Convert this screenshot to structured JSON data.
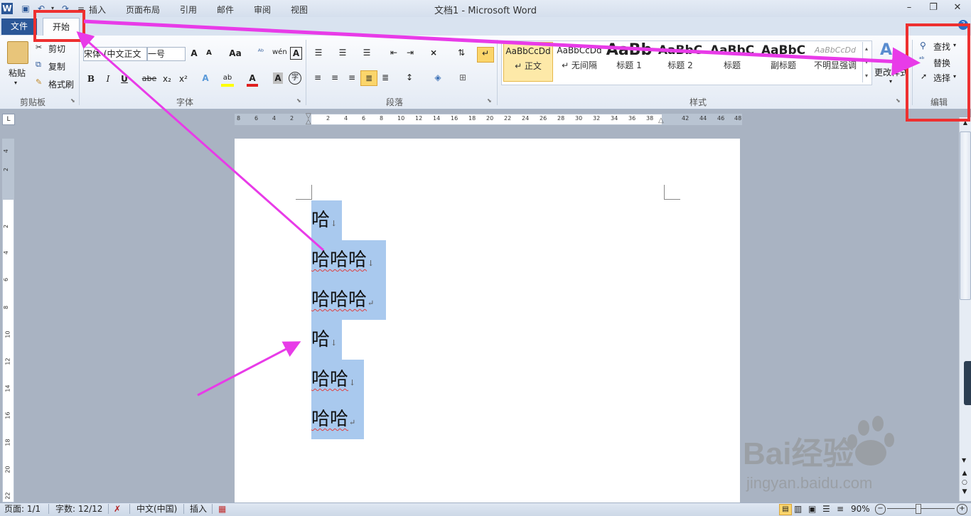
{
  "window": {
    "title": "文档1 - Microsoft Word"
  },
  "tabs": {
    "file": "文件",
    "home": "开始",
    "items": [
      "插入",
      "页面布局",
      "引用",
      "邮件",
      "审阅",
      "视图"
    ]
  },
  "clipboard": {
    "paste": "粘贴",
    "cut": "剪切",
    "copy": "复制",
    "format_painter": "格式刷",
    "label": "剪贴板"
  },
  "font": {
    "name": "宋体 (中文正文",
    "size": "一号",
    "label": "字体",
    "format_buttons": [
      "B",
      "I",
      "U",
      "abe",
      "x₂",
      "x²"
    ]
  },
  "paragraph": {
    "label": "段落"
  },
  "styles": {
    "label": "样式",
    "items": [
      {
        "sample": "AaBbCcDd",
        "name": "↵ 正文"
      },
      {
        "sample": "AaBbCcDd",
        "name": "↵ 无间隔"
      },
      {
        "sample": "AaBb",
        "name": "标题 1"
      },
      {
        "sample": "AaBbC",
        "name": "标题 2"
      },
      {
        "sample": "AaBbC",
        "name": "标题"
      },
      {
        "sample": "AaBbC",
        "name": "副标题"
      },
      {
        "sample": "AaBbCcDd",
        "name": "不明显强调"
      }
    ],
    "change_styles": "更改样式"
  },
  "editing": {
    "find": "查找",
    "replace": "替换",
    "select": "选择",
    "label": "编辑"
  },
  "document": {
    "lines": [
      {
        "text": "哈",
        "mark": "↓",
        "squiggle": false
      },
      {
        "text": "哈哈哈",
        "mark": "↓",
        "squiggle": true
      },
      {
        "text": "哈哈哈",
        "mark": "↵",
        "squiggle": true
      },
      {
        "text": "哈",
        "mark": "↓",
        "squiggle": false
      },
      {
        "text": "哈哈",
        "mark": "↓",
        "squiggle": true
      },
      {
        "text": "哈哈",
        "mark": "↵",
        "squiggle": true
      }
    ]
  },
  "ruler": {
    "ticks": [
      "8",
      "6",
      "4",
      "2",
      "2",
      "4",
      "6",
      "8",
      "10",
      "12",
      "14",
      "16",
      "18",
      "20",
      "22",
      "24",
      "26",
      "28",
      "30",
      "32",
      "34",
      "36",
      "38",
      "42",
      "44",
      "46",
      "48"
    ]
  },
  "vruler": {
    "ticks": [
      "4",
      "2",
      "2",
      "4",
      "6",
      "8",
      "10",
      "12",
      "14",
      "16",
      "18",
      "20",
      "22"
    ]
  },
  "status": {
    "page": "页面: 1/1",
    "words": "字数: 12/12",
    "language": "中文(中国)",
    "mode": "插入",
    "zoom": "90%"
  },
  "watermark": {
    "text": "Bai经验",
    "url": "jingyan.baidu.com"
  },
  "colors": {
    "annotation_red": "#ee3030",
    "arrow_magenta": "#e83be8",
    "selection": "#a9c9ee",
    "file_tab": "#2b5797"
  }
}
